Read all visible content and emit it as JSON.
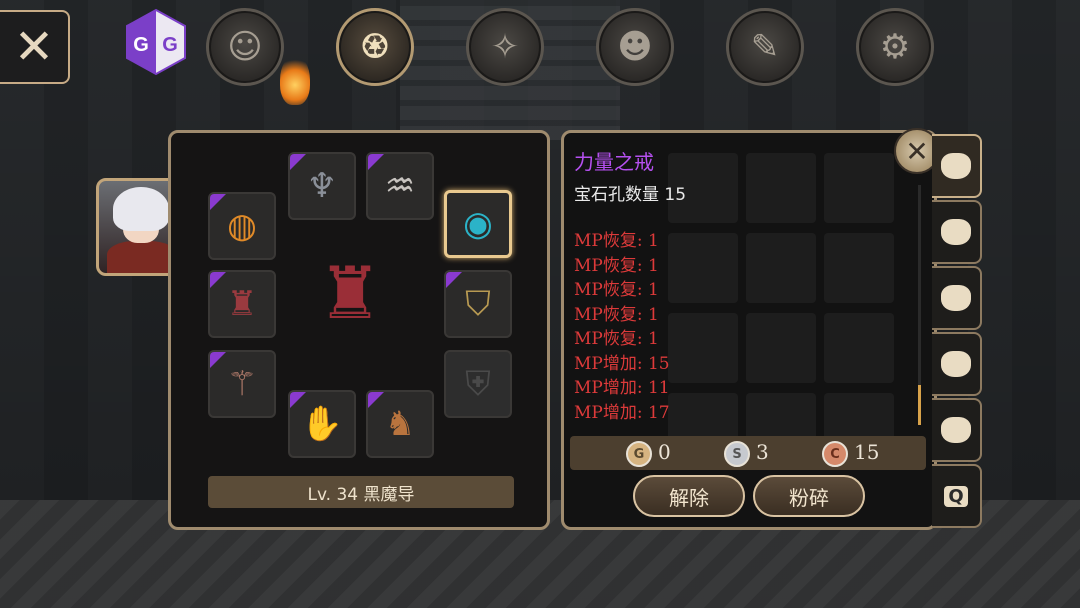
{
  "top_bar": {
    "close_icon": "close-x-icon",
    "gg_logo": "GG",
    "menu_buttons": [
      {
        "name": "character-menu",
        "icon": "head-profile-icon",
        "active": false
      },
      {
        "name": "inventory-menu",
        "icon": "bag-icon",
        "active": true
      },
      {
        "name": "skills-menu",
        "icon": "compass-sword-icon",
        "active": false
      },
      {
        "name": "party-menu",
        "icon": "people-icon",
        "active": false
      },
      {
        "name": "quest-menu",
        "icon": "scroll-icon",
        "active": false
      },
      {
        "name": "settings-menu",
        "icon": "gear-icon",
        "active": false
      }
    ]
  },
  "equipment": {
    "level_label": "Lv. 34 黑魔导",
    "slots": [
      {
        "name": "ring-left",
        "icon": "ring-icon",
        "tagged": true
      },
      {
        "name": "helmet",
        "icon": "horned-helmet-icon",
        "tagged": true
      },
      {
        "name": "necklace",
        "icon": "necklace-icon",
        "tagged": true
      },
      {
        "name": "ring-right",
        "icon": "ring-icon",
        "tagged": false,
        "selected": true
      },
      {
        "name": "armor",
        "icon": "armor-icon",
        "tagged": true
      },
      {
        "name": "cape",
        "icon": "cape-icon",
        "tagged": true
      },
      {
        "name": "weapon",
        "icon": "staff-icon",
        "tagged": true
      },
      {
        "name": "shield",
        "icon": "empty-shield-icon",
        "tagged": false
      },
      {
        "name": "gloves",
        "icon": "gloves-icon",
        "tagged": true
      },
      {
        "name": "boots",
        "icon": "boots-icon",
        "tagged": true
      }
    ]
  },
  "item_info": {
    "name": "力量之戒",
    "socket_count": "宝石孔数量 15",
    "stats": [
      "MP恢复: 1",
      "MP恢复: 1",
      "MP恢复: 1",
      "MP恢复: 1",
      "MP恢复: 1",
      "MP增加: 15",
      "MP增加: 11",
      "MP增加: 17"
    ],
    "colors": {
      "name": "#b550f0",
      "stat": "#dd3a3a"
    }
  },
  "currency": {
    "gold": {
      "symbol": "G",
      "value": "0"
    },
    "silver": {
      "symbol": "S",
      "value": "3"
    },
    "copper": {
      "symbol": "C",
      "value": "15"
    }
  },
  "actions": {
    "unequip_label": "解除",
    "smash_label": "粉碎"
  },
  "bag_tabs": [
    {
      "icon": "bag-icon",
      "active": true
    },
    {
      "icon": "bag-icon",
      "active": false
    },
    {
      "icon": "bag-icon",
      "active": false
    },
    {
      "icon": "bag-icon",
      "active": false
    },
    {
      "icon": "bag-icon",
      "active": false
    },
    {
      "icon": "quest-bag-icon",
      "label": "Q",
      "active": false
    }
  ]
}
